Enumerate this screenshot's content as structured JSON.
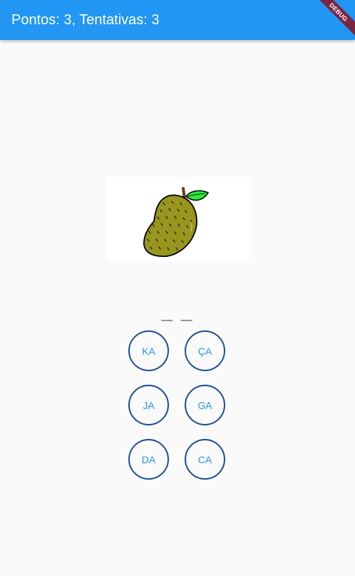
{
  "appbar": {
    "title": "Pontos: 3, Tentativas: 3",
    "color": "#2196f3"
  },
  "debug_banner": {
    "label": "DEBUG",
    "color": "#7a2542"
  },
  "picture": {
    "icon": "jackfruit-icon"
  },
  "word_slots": "_ _",
  "syllables": [
    {
      "label": "KA"
    },
    {
      "label": "ÇA"
    },
    {
      "label": "JA"
    },
    {
      "label": "GA"
    },
    {
      "label": "DA"
    },
    {
      "label": "CA"
    }
  ],
  "colors": {
    "button_border": "#1a4f96",
    "button_text": "#2196f3",
    "background": "#fafafa"
  }
}
